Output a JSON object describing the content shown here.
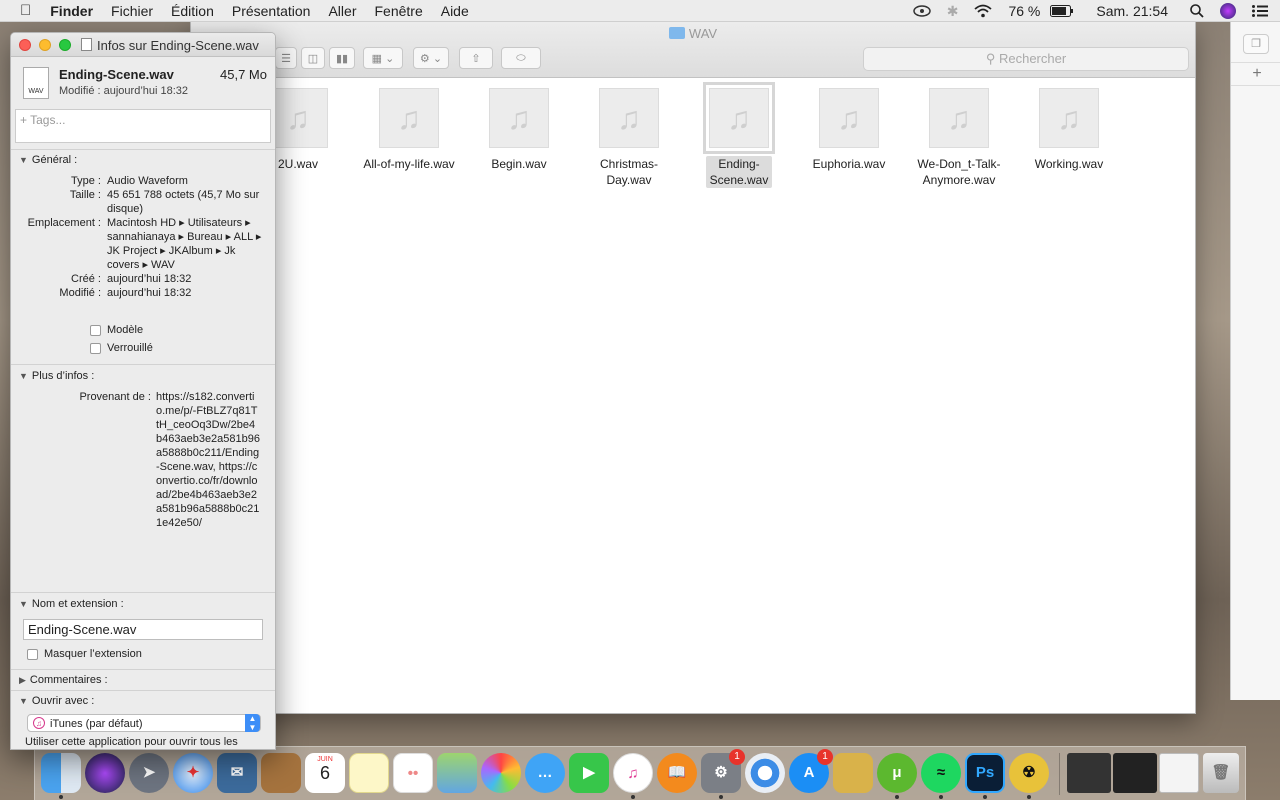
{
  "menubar": {
    "app": "Finder",
    "items": [
      "Fichier",
      "Édition",
      "Présentation",
      "Aller",
      "Fenêtre",
      "Aide"
    ],
    "battery": "76 %",
    "clock": "Sam. 21:54"
  },
  "finder": {
    "title": "WAV",
    "search_placeholder": "Rechercher",
    "files": [
      {
        "name": "2U.wav"
      },
      {
        "name": "All-of-my-life.wav"
      },
      {
        "name": "Begin.wav"
      },
      {
        "name": "Christmas-Day.wav"
      },
      {
        "name": "Ending-Scene.wav",
        "selected": true
      },
      {
        "name": "Euphoria.wav"
      },
      {
        "name": "We-Don_t-Talk-Anymore.wav"
      },
      {
        "name": "Working.wav"
      }
    ]
  },
  "info": {
    "window_title": "Infos sur Ending-Scene.wav",
    "file_name": "Ending-Scene.wav",
    "file_size": "45,7 Mo",
    "modified_summary": "Modifié :  aujourd’hui 18:32",
    "tags_placeholder": "+ Tags...",
    "general": {
      "heading": "Général :",
      "type_label": "Type :",
      "type_value": "Audio Waveform",
      "size_label": "Taille :",
      "size_value": "45 651 788 octets (45,7 Mo sur disque)",
      "location_label": "Emplacement :",
      "location_value": "Macintosh HD ▸ Utilisateurs ▸ sannahianaya ▸ Bureau ▸ ALL ▸ JK Project ▸ JKAlbum ▸ Jk covers ▸ WAV",
      "created_label": "Créé :",
      "created_value": "aujourd’hui 18:32",
      "modified_label": "Modifié :",
      "modified_value": "aujourd’hui 18:32",
      "template_label": "Modèle",
      "locked_label": "Verrouillé"
    },
    "more": {
      "heading": "Plus d’infos :",
      "from_label": "Provenant de :",
      "from_value": "https://s182.convertio.me/p/-FtBLZ7q81TtH_ceoOq3Dw/2be4b463aeb3e2a581b96a5888b0c211/Ending-Scene.wav, https://convertio.co/fr/download/2be4b463aeb3e2a581b96a5888b0c211e42e50/"
    },
    "name_ext": {
      "heading": "Nom et extension :",
      "value": "Ending-Scene.wav",
      "hide_ext_label": "Masquer l’extension"
    },
    "comments_heading": "Commentaires :",
    "open_with": {
      "heading": "Ouvrir avec :",
      "selected": "iTunes (par défaut)",
      "note": "Utiliser cette application pour ouvrir tous les"
    }
  },
  "dock": {
    "badges": {
      "system_prefs": "1",
      "app_store": "1"
    },
    "calendar_month": "JUIN",
    "calendar_day": "6"
  }
}
